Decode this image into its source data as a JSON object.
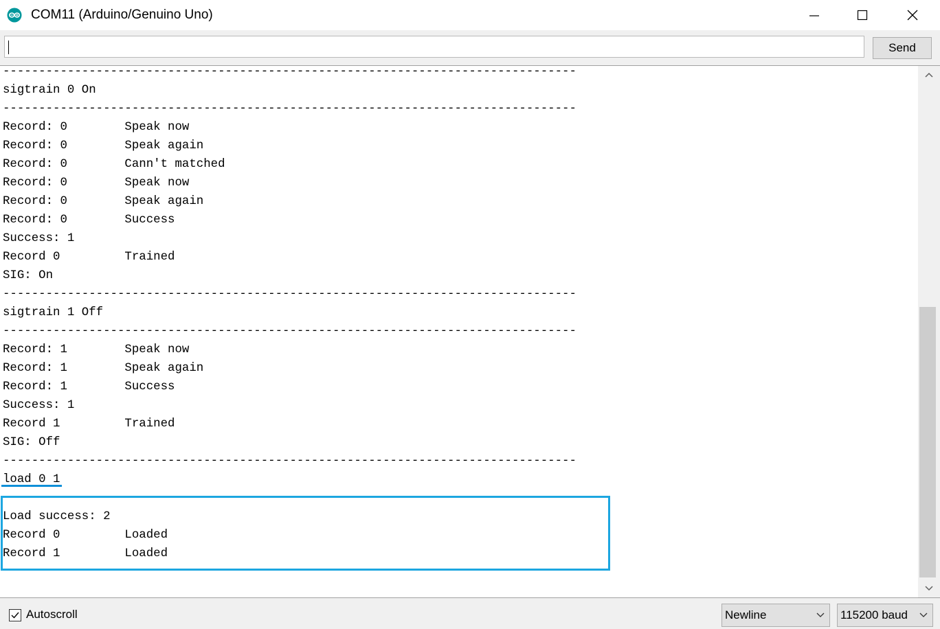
{
  "window": {
    "title": "COM11 (Arduino/Genuino Uno)"
  },
  "input": {
    "value": "",
    "send_label": "Send"
  },
  "output": {
    "lines": [
      "--------------------------------------------------------------------------------",
      "sigtrain 0 On",
      "--------------------------------------------------------------------------------",
      "Record: 0        Speak now",
      "Record: 0        Speak again",
      "Record: 0        Cann't matched",
      "Record: 0        Speak now",
      "Record: 0        Speak again",
      "Record: 0        Success",
      "Success: 1",
      "Record 0         Trained",
      "SIG: On",
      "--------------------------------------------------------------------------------",
      "sigtrain 1 Off",
      "--------------------------------------------------------------------------------",
      "Record: 1        Speak now",
      "Record: 1        Speak again",
      "Record: 1        Success",
      "Success: 1",
      "Record 1         Trained",
      "SIG: Off",
      "--------------------------------------------------------------------------------",
      "load 0 1",
      "",
      "Load success: 2",
      "Record 0         Loaded",
      "Record 1         Loaded"
    ]
  },
  "statusbar": {
    "autoscroll_label": "Autoscroll",
    "autoscroll_checked": true,
    "line_ending": "Newline",
    "baud_rate": "115200 baud"
  },
  "colors": {
    "highlight": "#1ca6e0",
    "arduino_teal": "#00979c"
  },
  "icons": {
    "app": "arduino-icon",
    "minimize": "minimize-icon",
    "maximize": "maximize-icon",
    "close": "close-icon",
    "scroll_up": "chevron-up-icon",
    "scroll_down": "chevron-down-icon",
    "checkbox": "checkmark-icon",
    "dropdown": "chevron-down-icon"
  }
}
